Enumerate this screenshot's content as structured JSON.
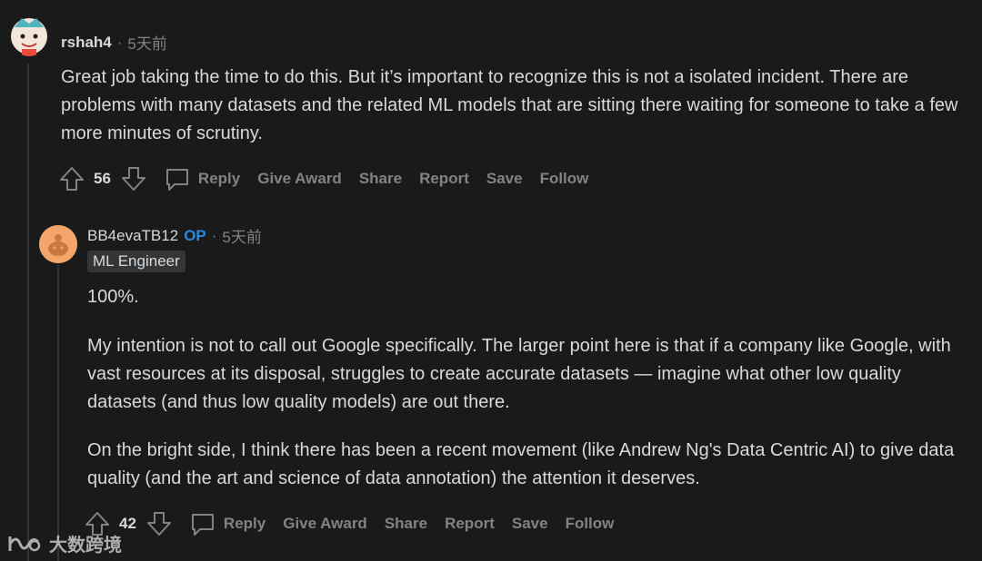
{
  "comment1": {
    "username": "rshah4",
    "time": "5天前",
    "body": "Great job taking the time to do this. But it’s important to recognize this is not a isolated incident. There are problems with many datasets and the related ML models that are sitting there waiting for someone to take a few more minutes of scrutiny.",
    "votes": "56",
    "actions": {
      "reply": "Reply",
      "award": "Give Award",
      "share": "Share",
      "report": "Report",
      "save": "Save",
      "follow": "Follow"
    }
  },
  "comment2": {
    "username": "BB4evaTB12",
    "op_badge": "OP",
    "time": "5天前",
    "flair": "ML Engineer",
    "paragraphs": [
      "100%.",
      "My intention is not to call out Google specifically. The larger point here is that if a company like Google, with vast resources at its disposal, struggles to create accurate datasets — imagine what other low quality datasets (and thus low quality models) are out there.",
      "On the bright side, I think there has been a recent movement (like Andrew Ng's Data Centric AI) to give data quality (and the art and science of data annotation) the attention it deserves."
    ],
    "votes": "42",
    "actions": {
      "reply": "Reply",
      "award": "Give Award",
      "share": "Share",
      "report": "Report",
      "save": "Save",
      "follow": "Follow"
    }
  },
  "separator": "·",
  "watermark": {
    "text": "大数跨境"
  },
  "colors": {
    "background": "#1a1a1b",
    "text": "#d7dadc",
    "muted": "#818384",
    "op": "#2a8ae1",
    "flair_bg": "#343536"
  }
}
